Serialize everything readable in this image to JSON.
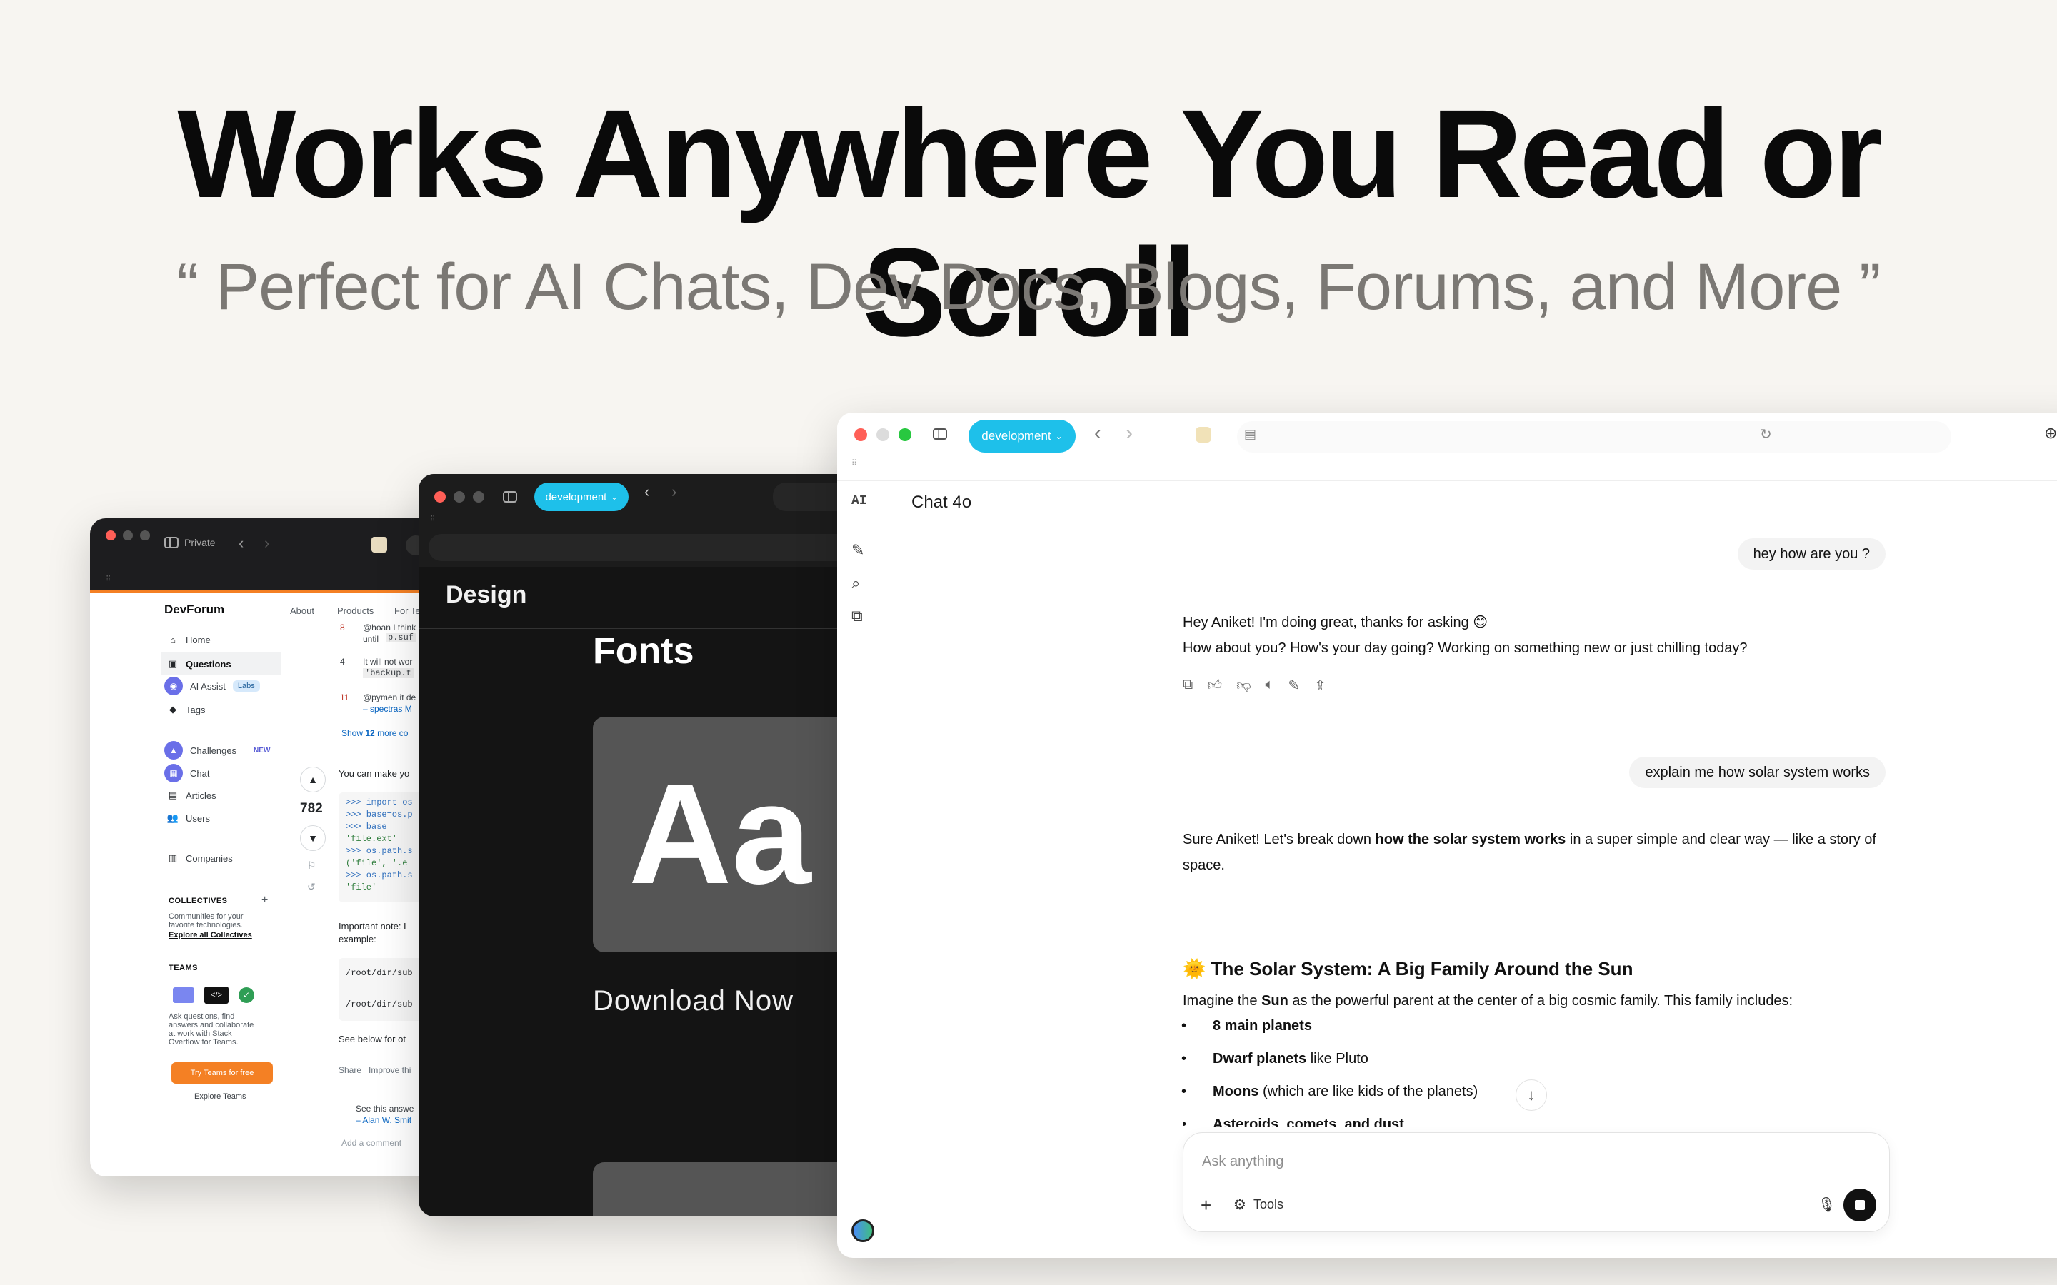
{
  "hero": {
    "title": "Works Anywhere You Read or Scroll",
    "subtitle": "“ Perfect for AI Chats, Dev Docs, Blogs, Forums, and More ”"
  },
  "colors": {
    "accent_blue": "#1ec0ea",
    "devforum_orange": "#f48024",
    "traffic_red": "#ff5f57",
    "traffic_yellow": "#febc2e",
    "traffic_green": "#28c840"
  },
  "devforum": {
    "tab_label": "Private",
    "logo": "DevForum",
    "nav": [
      "About",
      "Products",
      "For Te"
    ],
    "sidebar": {
      "home": "Home",
      "questions": "Questions",
      "ai_assist": "AI Assist",
      "labs_badge": "Labs",
      "tags": "Tags",
      "challenges": "Challenges",
      "new_badge": "NEW",
      "chat": "Chat",
      "articles": "Articles",
      "users": "Users",
      "companies": "Companies",
      "collectives_heading": "COLLECTIVES",
      "collectives_plus": "+",
      "collectives_desc_1": "Communities for your",
      "collectives_desc_2": "favorite technologies.",
      "collectives_link": "Explore all Collectives",
      "teams_heading": "TEAMS",
      "teams_desc_1": "Ask questions, find",
      "teams_desc_2": "answers and collaborate",
      "teams_desc_3": "at work with Stack",
      "teams_desc_4": "Overflow for Teams.",
      "teams_button": "Try Teams for free",
      "explore_teams": "Explore Teams"
    },
    "main": {
      "comment_1_num": "8",
      "comment_1_a": "@hoan I think",
      "comment_1_b": "until",
      "comment_1_code": "p.suf",
      "comment_2_num": "4",
      "comment_2_a": "It will not wor",
      "comment_2_code": "'backup.t",
      "comment_3_num": "11",
      "comment_3_a": "@pymen it de",
      "comment_3_b": "– spectras M",
      "show_more_prefix": "Show",
      "show_more_count": "12",
      "show_more_suffix": "more co",
      "vote_count": "782",
      "answer_intro": "You can make yo",
      "code_lines": [
        ">>> import os",
        ">>> base=os.p",
        ">>> base",
        "'file.ext'",
        ">>> os.path.s",
        "('file', '.e",
        ">>> os.path.s",
        "'file'"
      ],
      "note_1": "Important note: I",
      "note_2": "example:",
      "path_1": "/root/dir/sub",
      "path_2": "/root/dir/sub",
      "see_below": "See below for ot",
      "share": "Share",
      "improve": "Improve thi",
      "see_this": "See this answe",
      "alan": "– Alan W. Smit",
      "add_comment": "Add a comment"
    }
  },
  "design": {
    "branch": "development",
    "title": "Design",
    "fonts": "Fonts",
    "sample": "Aa",
    "download": "Download Now"
  },
  "chat": {
    "branch": "development",
    "title": "Chat 4o",
    "rail_logo": "AI",
    "user_msg_1": "hey how are you ?",
    "asst_1_line1": "Hey Aniket! I'm doing great, thanks for asking 😊",
    "asst_1_line2": "How about you? How's your day going? Working on something new or just chilling today?",
    "user_msg_2": "explain me how solar system works",
    "asst_2_a": "Sure Aniket! Let's break down",
    "asst_2_bold": "how the solar system works",
    "asst_2_b": "in a super simple and clear way — like a story",
    "asst_2_c": "of space.",
    "heading": "🌞 The Solar System: A Big Family Around the Sun",
    "intro_a": "Imagine the",
    "intro_bold": "Sun",
    "intro_b": "as the powerful parent at the center of a big cosmic family. This family includes:",
    "bullet_1_bold": "8 main planets",
    "bullet_2_bold": "Dwarf planets",
    "bullet_2_rest": "like Pluto",
    "bullet_3_bold": "Moons",
    "bullet_3_rest": "(which are like kids of the planets)",
    "bullet_4_partial": "Asteroids, comets, and dust",
    "composer_placeholder": "Ask anything",
    "tools_label": "Tools"
  }
}
